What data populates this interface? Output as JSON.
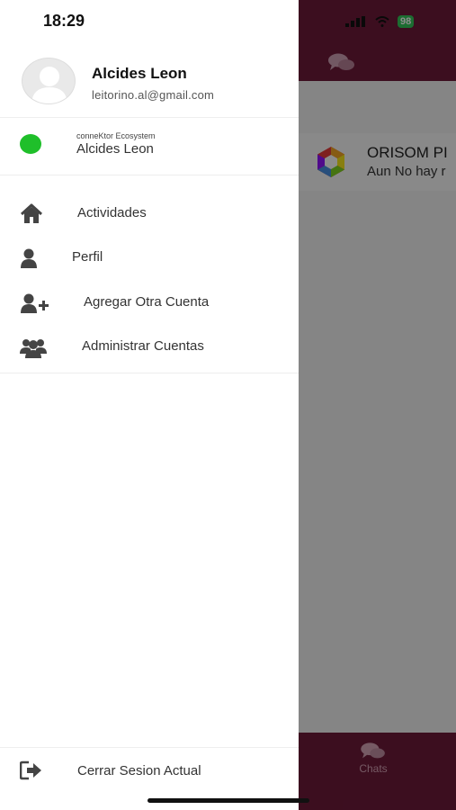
{
  "status_bar": {
    "time": "18:29",
    "battery": "98"
  },
  "profile": {
    "name": "Alcides Leon",
    "email": "leitorino.al@gmail.com"
  },
  "account": {
    "ecosystem": "conneKtor Ecosystem",
    "name": "Alcides Leon",
    "status_color": "#1fbf2a"
  },
  "menu": [
    {
      "label": "Actividades",
      "icon": "home-icon"
    },
    {
      "label": "Perfil",
      "icon": "user-icon"
    },
    {
      "label": "Agregar Otra Cuenta",
      "icon": "user-plus-icon"
    },
    {
      "label": "Administrar Cuentas",
      "icon": "users-icon"
    }
  ],
  "logout": {
    "label": "Cerrar Sesion Actual",
    "icon": "sign-out-icon"
  },
  "background_app": {
    "chat_title": "ORISOM PI",
    "chat_subtitle": "Aun No hay r",
    "bottom_tab": "Chats"
  },
  "colors": {
    "brand": "#6e1a3a",
    "online": "#1fbf2a",
    "battery": "#34c759"
  }
}
